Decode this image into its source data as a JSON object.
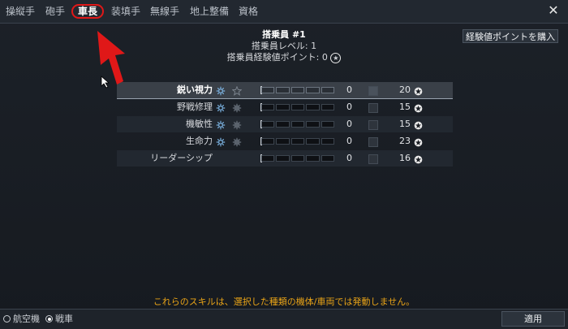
{
  "tabs": [
    {
      "label": "操縦手",
      "active": false
    },
    {
      "label": "砲手",
      "active": false
    },
    {
      "label": "車長",
      "active": true
    },
    {
      "label": "装填手",
      "active": false
    },
    {
      "label": "無線手",
      "active": false
    },
    {
      "label": "地上整備",
      "active": false
    },
    {
      "label": "資格",
      "active": false
    }
  ],
  "close_label": "✕",
  "crew": {
    "name": "搭乗員 #1",
    "level_text": "搭乗員レベル: 1",
    "points_text": "搭乗員経験値ポイント: 0"
  },
  "buy_button_label": "経験値ポイントを購入",
  "skills": [
    {
      "name": "鋭い視力",
      "level": "0",
      "cost": "20",
      "bar_fraction": 0
    },
    {
      "name": "野戦修理",
      "level": "0",
      "cost": "15",
      "bar_fraction": 0
    },
    {
      "name": "機敏性",
      "level": "0",
      "cost": "15",
      "bar_fraction": 0
    },
    {
      "name": "生命力",
      "level": "0",
      "cost": "23",
      "bar_fraction": 0
    },
    {
      "name": "リーダーシップ",
      "level": "0",
      "cost": "16",
      "bar_fraction": 0
    }
  ],
  "warning": "これらのスキルは、選択した種類の機体/車両では発動しません。",
  "vehicle_type": {
    "options": [
      {
        "label": "航空機",
        "selected": false
      },
      {
        "label": "戦車",
        "selected": true
      }
    ]
  },
  "apply_label": "適用",
  "colors": {
    "accent_red": "#e01818",
    "warning": "#e8a317",
    "highlight_row": "#3a4048"
  }
}
